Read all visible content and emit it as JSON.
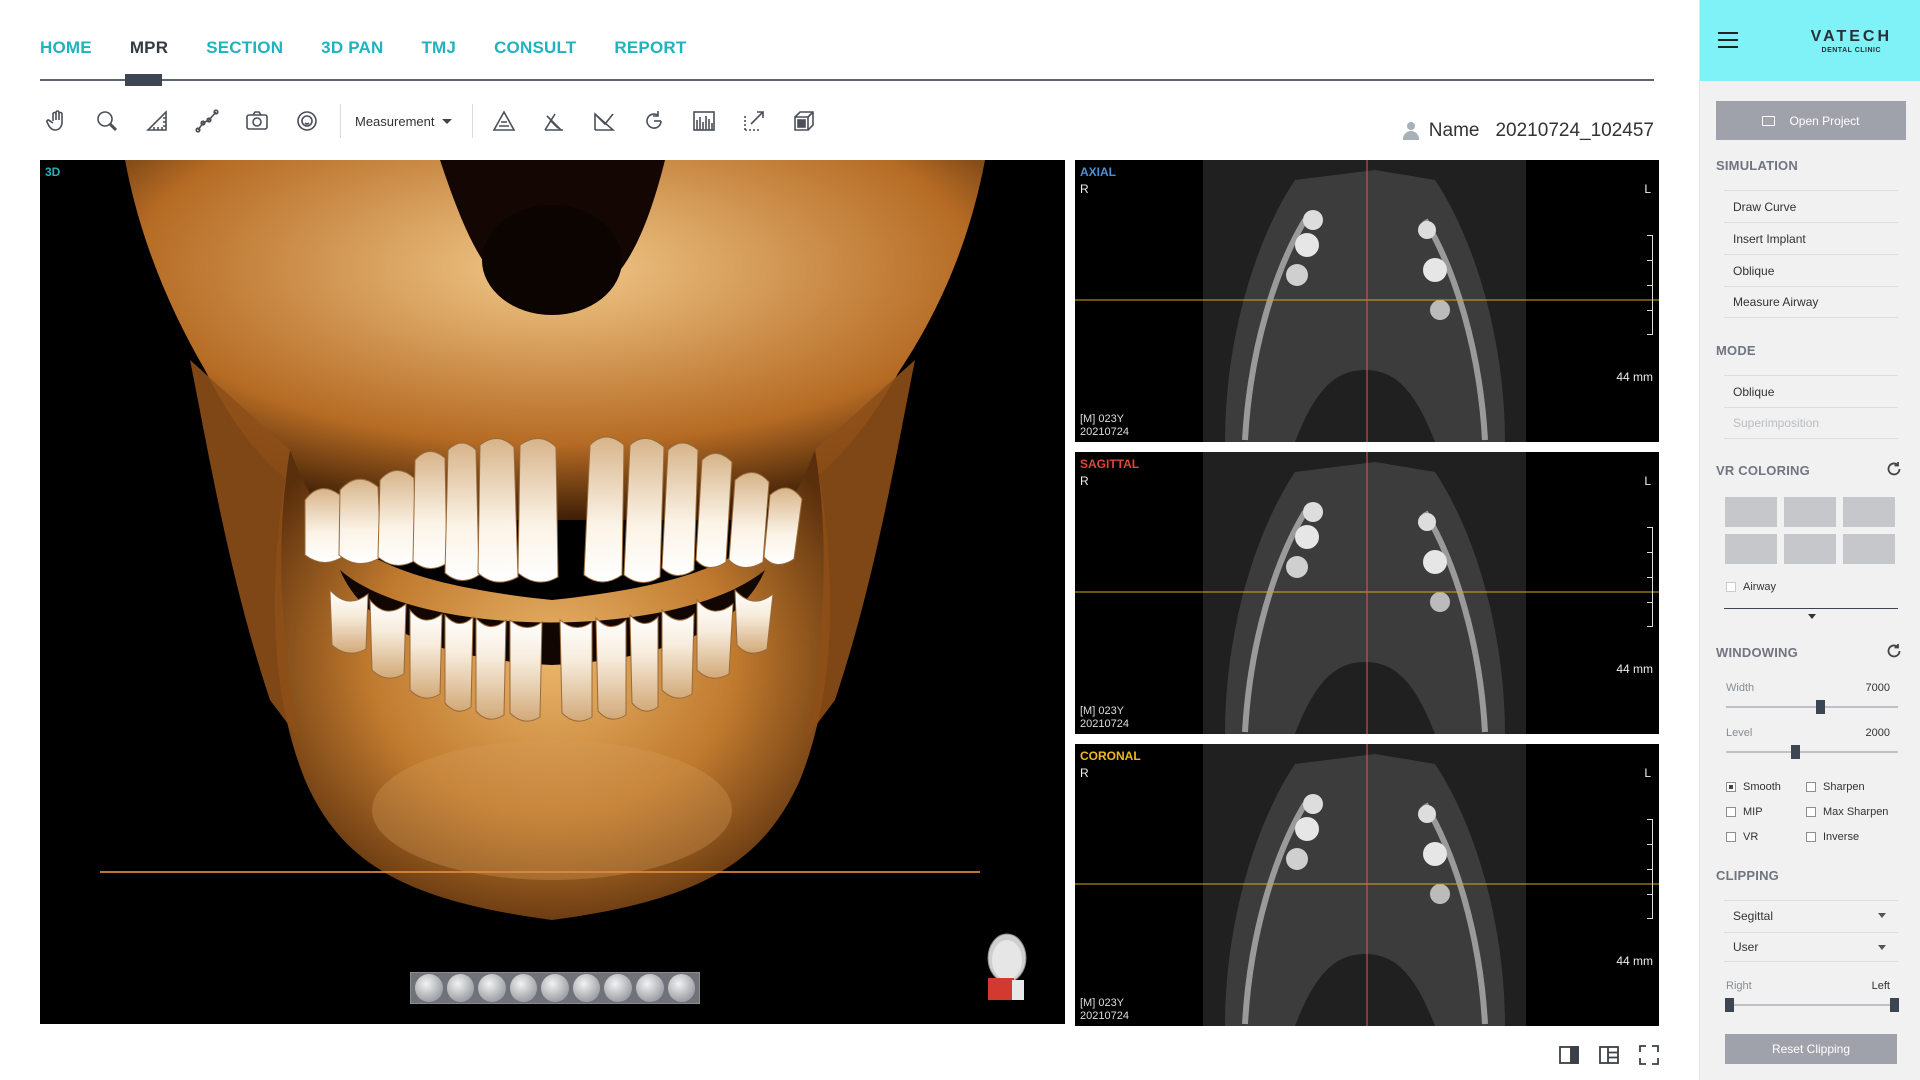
{
  "nav": {
    "tabs": [
      "HOME",
      "MPR",
      "SECTION",
      "3D PAN",
      "TMJ",
      "CONSULT",
      "REPORT"
    ],
    "active": "MPR"
  },
  "toolbar": {
    "measurement_label": "Measurement"
  },
  "patient": {
    "name_label": "Name",
    "name_value": "20210724_102457"
  },
  "views": {
    "main": {
      "label": "3D",
      "label_color": "#1fb2bf"
    },
    "axial": {
      "label": "AXIAL",
      "label_color": "#4f8fd6",
      "R": "R",
      "L": "L",
      "scale": "44 mm",
      "info1": "[M] 023Y",
      "info2": "20210724"
    },
    "sagittal": {
      "label": "SAGITTAL",
      "label_color": "#e0443a",
      "R": "R",
      "L": "L",
      "scale": "44 mm",
      "info1": "[M] 023Y",
      "info2": "20210724"
    },
    "coronal": {
      "label": "CORONAL",
      "label_color": "#f0b81d",
      "R": "R",
      "L": "L",
      "scale": "44 mm",
      "info1": "[M] 023Y",
      "info2": "20210724"
    }
  },
  "panel": {
    "brand_line1": "VATECH",
    "brand_line2": "DENTAL CLINIC",
    "open_project": "Open Project",
    "simulation": {
      "title": "SIMULATION",
      "items": [
        "Draw Curve",
        "Insert Implant",
        "Oblique",
        "Measure Airway"
      ]
    },
    "mode": {
      "title": "MODE",
      "items": [
        "Oblique",
        "Superimposition"
      ]
    },
    "vr_coloring": {
      "title": "VR COLORING",
      "airway_label": "Airway",
      "airway_checked": false
    },
    "windowing": {
      "title": "WINDOWING",
      "width_label": "Width",
      "width_value": "7000",
      "width_fraction": 0.55,
      "level_label": "Level",
      "level_value": "2000",
      "level_fraction": 0.4,
      "options": {
        "smooth": "Smooth",
        "sharpen": "Sharpen",
        "mip": "MIP",
        "max_sharpen": "Max Sharpen",
        "vr": "VR",
        "inverse": "Inverse"
      },
      "checked": "Smooth"
    },
    "clipping": {
      "title": "CLIPPING",
      "select1": "Segittal",
      "select2": "User",
      "right_label": "Right",
      "left_label": "Left",
      "reset_label": "Reset Clipping"
    }
  }
}
